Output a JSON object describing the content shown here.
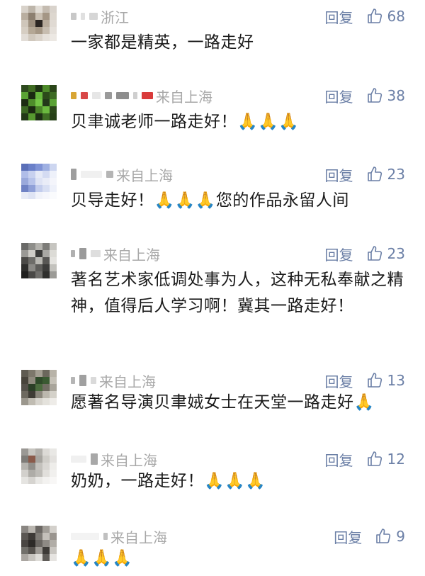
{
  "reply_label": "回复",
  "colors": {
    "link": "#6b7fa6",
    "location": "#a8a8a8"
  },
  "comments": [
    {
      "location": "浙江",
      "likes": "68",
      "text": "一家都是精英，一路走好"
    },
    {
      "location": "来自上海",
      "likes": "38",
      "text": "贝聿诚老师一路走好！🙏🙏🙏"
    },
    {
      "location": "来自上海",
      "likes": "23",
      "text": "贝导走好！🙏🙏🙏您的作品永留人间"
    },
    {
      "location": "来自上海",
      "likes": "23",
      "text": "著名艺术家低调处事为人，这种无私奉献之精神，值得后人学习啊！冀其一路走好！"
    },
    {
      "location": "来自上海",
      "likes": "13",
      "text": "愿著名导演贝聿娀女士在天堂一路走好🙏"
    },
    {
      "location": "来自上海",
      "likes": "12",
      "text": "奶奶，一路走好！🙏🙏🙏"
    },
    {
      "location": "来自上海",
      "likes": "9",
      "text": "🙏🙏🙏"
    }
  ]
}
